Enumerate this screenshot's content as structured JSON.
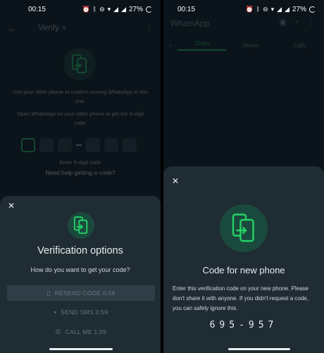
{
  "left": {
    "status": {
      "time": "00:15",
      "battery": "27%"
    },
    "appbar": {
      "title": "Verify +"
    },
    "body": {
      "line1": "Use your other phone to confirm moving WhatsApp to this one.",
      "line2": "Open WhatsApp on your other phone to get the 6-digit code.",
      "code_hint": "Enter 6-digit code",
      "help": "Need help getting a code?"
    },
    "sheet": {
      "title": "Verification options",
      "subtitle": "How do you want to get your code?",
      "options": [
        {
          "label": "RESEND CODE  0:59",
          "icon": "phone-transfer-icon"
        },
        {
          "label": "SEND SMS  0:59",
          "icon": "message-icon"
        },
        {
          "label": "CALL ME  1:59",
          "icon": "phone-icon"
        }
      ]
    }
  },
  "right": {
    "status": {
      "time": "00:15",
      "battery": "27%"
    },
    "appbar": {
      "title": "WhatsApp"
    },
    "tabs": [
      "Chats",
      "Status",
      "Calls"
    ],
    "sheet": {
      "title": "Code for new phone",
      "body": "Enter this verification code on your new phone. Please don't share it with anyone. If you didn't request a code, you can safely ignore this.",
      "code": "695-957"
    }
  },
  "colors": {
    "accent": "#25d366",
    "sheet": "#1f2c33",
    "background": "#0b141a"
  }
}
